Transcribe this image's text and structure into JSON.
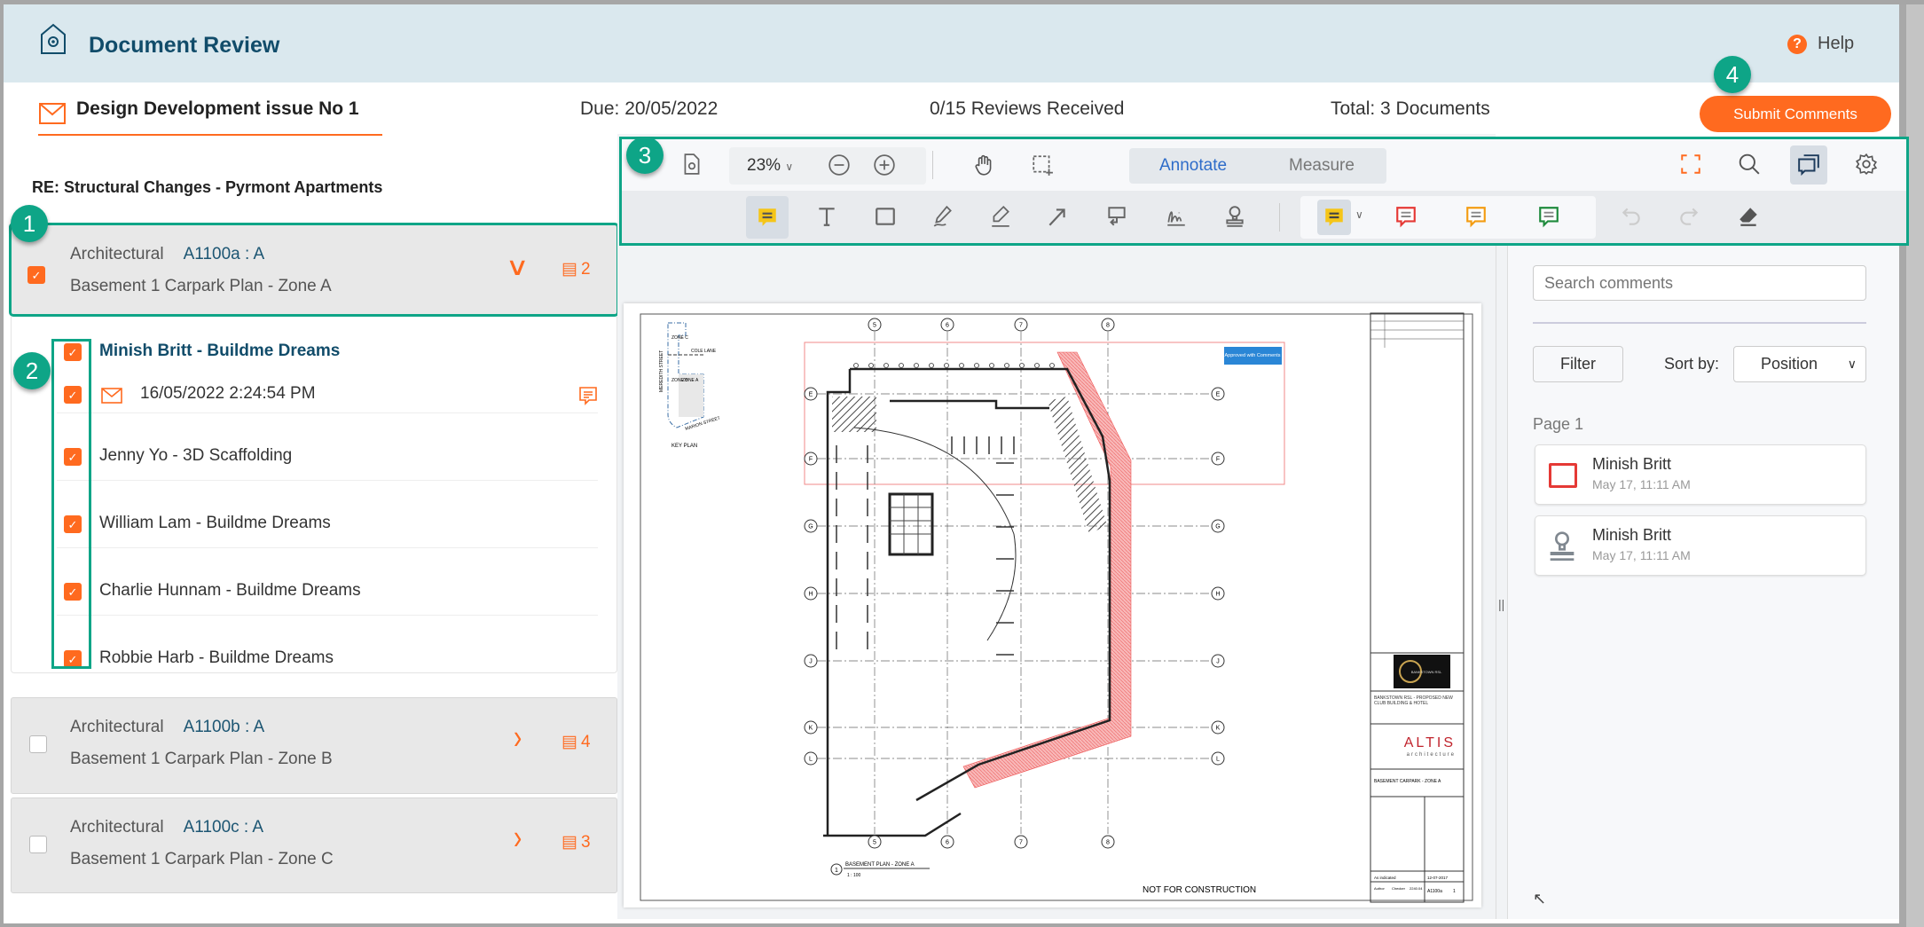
{
  "header": {
    "title": "Document Review",
    "help": "Help",
    "logo_icon": "house-gear-icon",
    "help_icon": "question-circle-icon"
  },
  "review": {
    "name": "Design Development issue No 1",
    "due": "Due: 20/05/2022",
    "reviews": "0/15 Reviews Received",
    "total": "Total: 3 Documents",
    "submit": "Submit Comments",
    "subject": "RE: Structural Changes - Pyrmont Apartments"
  },
  "badges": [
    "1",
    "2",
    "3",
    "4"
  ],
  "documents": [
    {
      "discipline": "Architectural",
      "code": "A1100a : A",
      "title": "Basement 1 Carpark Plan - Zone A",
      "comments": "2",
      "checked": true,
      "expanded": true
    },
    {
      "discipline": "Architectural",
      "code": "A1100b : A",
      "title": "Basement 1 Carpark Plan - Zone B",
      "comments": "4",
      "checked": false,
      "expanded": false
    },
    {
      "discipline": "Architectural",
      "code": "A1100c : A",
      "title": "Basement 1 Carpark Plan - Zone C",
      "comments": "3",
      "checked": false,
      "expanded": false
    }
  ],
  "reviewers": [
    {
      "name": "Minish Britt - Buildme Dreams",
      "date": "16/05/2022 2:24:54 PM",
      "checked": true
    },
    {
      "name": "Jenny Yo - 3D Scaffolding",
      "checked": true
    },
    {
      "name": "William Lam - Buildme Dreams",
      "checked": true
    },
    {
      "name": "Charlie Hunnam - Buildme Dreams",
      "checked": true
    },
    {
      "name": "Robbie Harb - Buildme Dreams",
      "checked": true
    }
  ],
  "toolbar": {
    "zoom": "23%",
    "tabs": [
      "Annotate",
      "Measure"
    ],
    "active_tab": "Annotate",
    "note_colors": {
      "yellow": "#f5c518",
      "red": "#e53935",
      "orange": "#f39c12",
      "green": "#1e8a3c"
    }
  },
  "drawing": {
    "columns": [
      "5",
      "6",
      "7",
      "8"
    ],
    "rows": [
      "E",
      "F",
      "G",
      "H",
      "J",
      "K",
      "L"
    ],
    "keyplan": {
      "title": "KEY PLAN",
      "zones": [
        "ZONE C",
        "ZONE B",
        "ZONE A"
      ],
      "streets": [
        "MEREDITH STREET",
        "COLE LANE",
        "MARION STREET"
      ]
    },
    "stamp": "Approved with Comments",
    "plan_title": "BASEMENT PLAN - ZONE A",
    "plan_scale": "1 : 100",
    "plan_no": "1",
    "not_for_construction": "NOT FOR CONSTRUCTION",
    "client_logo": "BANKSTOWN RSL",
    "project": "BANKSTOWN RSL - PROPOSED NEW CLUB BUILDING & HOTEL",
    "architect": "ALTIS",
    "architect_sub": "architecture",
    "sheet_title": "BASEMENT CARPARK - ZONE A",
    "scale": "As indicated",
    "sheet_no": "A1100a",
    "rev": "1",
    "date": "12-07-2017",
    "drawn": "Author",
    "checked": "Checker",
    "job": "2240.04"
  },
  "comments_panel": {
    "search_placeholder": "Search comments",
    "filter": "Filter",
    "sort_label": "Sort by:",
    "sort_value": "Position",
    "page": "Page 1",
    "items": [
      {
        "author": "Minish Britt",
        "date": "May 17, 11:11 AM",
        "type": "rectangle",
        "color": "#e53935"
      },
      {
        "author": "Minish Britt",
        "date": "May 17, 11:11 AM",
        "type": "stamp",
        "color": "#808890"
      }
    ]
  },
  "colors": {
    "accent": "#ff6a1f",
    "brand": "#114c6a",
    "callout": "#0ea587",
    "header_bg": "#dae8ee"
  }
}
